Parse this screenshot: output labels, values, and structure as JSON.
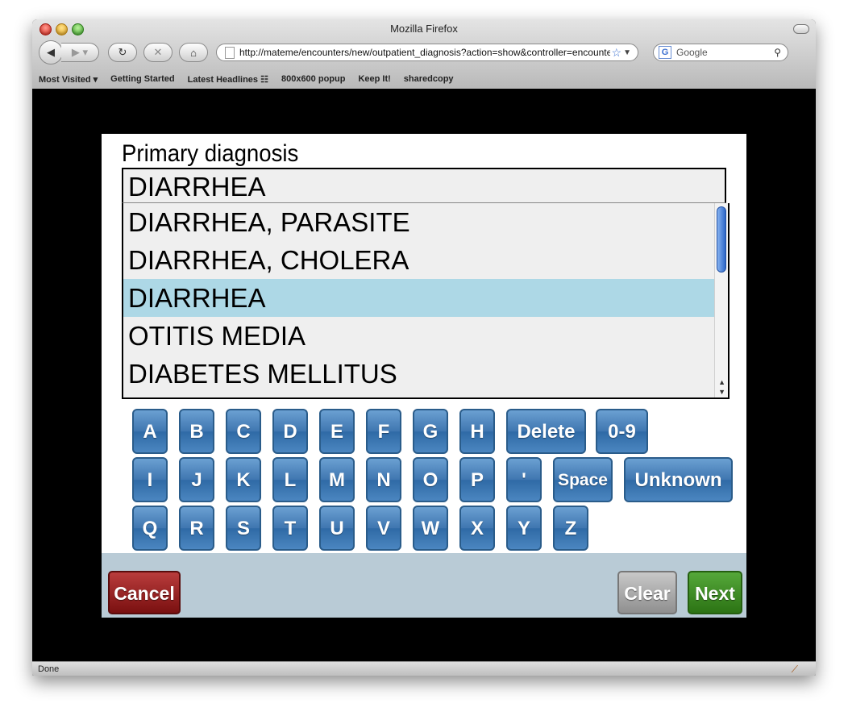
{
  "browser": {
    "window_title": "Mozilla Firefox",
    "url": "http://mateme/encounters/new/outpatient_diagnosis?action=show&controller=encounters",
    "search_placeholder": "Google",
    "search_engine_letter": "G",
    "bookmarks": [
      "Most Visited ▾",
      "Getting Started",
      "Latest Headlines ☷",
      "800x600 popup",
      "Keep It!",
      "sharedcopy"
    ],
    "status": "Done"
  },
  "question": {
    "label": "Primary diagnosis",
    "input_value": "DIARRHEA"
  },
  "options": {
    "items": [
      "DIARRHEA, PARASITE",
      "DIARRHEA, CHOLERA",
      "DIARRHEA",
      "OTITIS MEDIA",
      "DIABETES MELLITUS"
    ],
    "selected_index": 2,
    "selected_color": "#add8e6"
  },
  "keyboard": {
    "row1": [
      "A",
      "B",
      "C",
      "D",
      "E",
      "F",
      "G",
      "H"
    ],
    "row2": [
      "I",
      "J",
      "K",
      "L",
      "M",
      "N",
      "O",
      "P",
      "'"
    ],
    "row3": [
      "Q",
      "R",
      "S",
      "T",
      "U",
      "V",
      "W",
      "X",
      "Y",
      "Z"
    ],
    "delete_label": "Delete",
    "numbers_label": "0-9",
    "space_label": "Space",
    "unknown_label": "Unknown"
  },
  "nav": {
    "cancel_label": "Cancel",
    "clear_label": "Clear",
    "next_label": "Next",
    "cancel_color": "#7a1010",
    "clear_color": "#8f8f8f",
    "next_color": "#2c7314"
  }
}
